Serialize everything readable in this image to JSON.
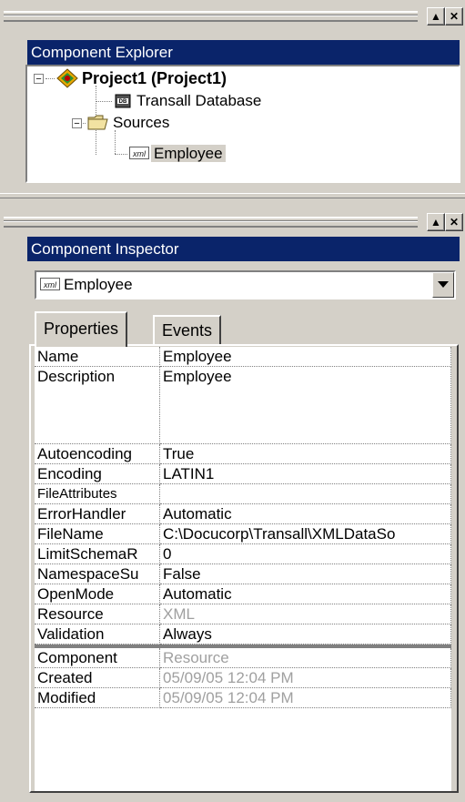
{
  "component_explorer": {
    "title": "Component Explorer",
    "tree": [
      {
        "label": "Project1 (Project1)",
        "bold": true,
        "icon": "project-icon"
      },
      {
        "label": "Transall Database",
        "icon": "database-icon"
      },
      {
        "label": "Sources",
        "icon": "folder-icon"
      },
      {
        "label": "Employee",
        "icon": "xml-icon",
        "selected": true
      }
    ]
  },
  "component_inspector": {
    "title": "Component Inspector",
    "selected_component": "Employee",
    "tabs": [
      "Properties",
      "Events"
    ],
    "properties": [
      {
        "name": "Name",
        "value": "Employee"
      },
      {
        "name": "Description",
        "value": "Employee"
      },
      {
        "name": "Autoencoding",
        "value": "True"
      },
      {
        "name": "Encoding",
        "value": "LATIN1"
      },
      {
        "name": "FileAttributes",
        "value": ""
      },
      {
        "name": "ErrorHandler",
        "value": "Automatic"
      },
      {
        "name": "FileName",
        "value": "C:\\Docucorp\\Transall\\XMLDataSo"
      },
      {
        "name": "LimitSchemaR",
        "value": "0"
      },
      {
        "name": "NamespaceSu",
        "value": "False"
      },
      {
        "name": "OpenMode",
        "value": "Automatic"
      },
      {
        "name": "Resource",
        "value": "XML"
      },
      {
        "name": "Validation",
        "value": "Always"
      }
    ],
    "readonly_properties": [
      {
        "name": "Component",
        "value": "Resource"
      },
      {
        "name": "Created",
        "value": "05/09/05 12:04 PM"
      },
      {
        "name": "Modified",
        "value": "05/09/05 12:04 PM"
      }
    ]
  },
  "colors": {
    "titlebar": "#0a246a",
    "face": "#d4d0c8",
    "disabled_text": "#a0a0a0"
  }
}
